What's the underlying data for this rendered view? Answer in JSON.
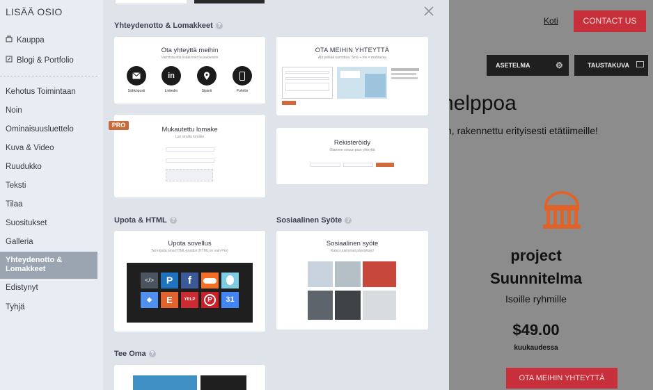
{
  "sidebar": {
    "title": "LISÄÄ OSIO",
    "top_items": [
      {
        "label": "Kauppa",
        "icon": "shop-icon"
      },
      {
        "label": "Blogi & Portfolio",
        "icon": "edit-icon"
      }
    ],
    "items": [
      "Kehotus Toimintaan",
      "Noin",
      "Ominaisuusluettelo",
      "Kuva & Video",
      "Ruudukko",
      "Teksti",
      "Tilaa",
      "Suositukset",
      "Galleria"
    ],
    "active": "Yhteydenotto & Lomakkeet",
    "bottom_items": [
      "Edistynyt",
      "Tyhjä"
    ]
  },
  "panel": {
    "sections": {
      "contact": "Yhteydenotto & Lomakkeet",
      "embed": "Upota & HTML",
      "social": "Sosiaalinen Syöte",
      "own": "Tee Oma"
    },
    "card_contact": {
      "title": "Ota yhteyttä meihin",
      "subtitle": "Varmista että lisäät linkit kuvakkeisiin",
      "icons": [
        {
          "label": "Sähköposti",
          "icon": "mail-icon"
        },
        {
          "label": "Linkedin",
          "icon": "linkedin-icon"
        },
        {
          "label": "Sijainti",
          "icon": "location-icon"
        },
        {
          "label": "Puhelin",
          "icon": "phone-icon"
        }
      ]
    },
    "card_ota": {
      "title": "OTA MEIHIN YHTEYTTÄ",
      "subtitle": "Älä pelkää kuinottaa. Sinä + me = mahtavaa"
    },
    "card_custom": {
      "badge": "PRO",
      "title": "Mukautettu lomake",
      "subtitle": "Luo sinulta lomake"
    },
    "card_register": {
      "title": "Rekisteröidy",
      "subtitle": "Otamme sinuun pian yhteyttä"
    },
    "card_embed": {
      "title": "Upota sovellus",
      "subtitle": "Tai kirjoita oma HTML-koodisi (HTML on vain Pro)"
    },
    "card_social": {
      "title": "Sosiaalinen syöte",
      "subtitle": "Katso uusimmat päivitykset!"
    }
  },
  "site": {
    "nav_home": "Koti",
    "contact_button": "CONTACT US",
    "settings_button": "ASETELMA",
    "background_button": "TAUSTAKUVA",
    "heading_fragment": "helppoa",
    "subheading_fragment": "n, rakennettu erityisesti etätiimeille!",
    "plan_name_1": "project",
    "plan_name_2": "Suunnitelma",
    "plan_desc": "Isoille ryhmille",
    "price": "$49.00",
    "period": "kuukaudessa",
    "cta": "OTA MEIHIN YHTEYTTÄ"
  },
  "colors": {
    "accent": "#c72f3a",
    "pro_badge": "#c96a3a",
    "active_item": "#9ba4b1",
    "panel_bg": "#dfe3ea",
    "sidebar_bg": "#e9ecf2"
  }
}
